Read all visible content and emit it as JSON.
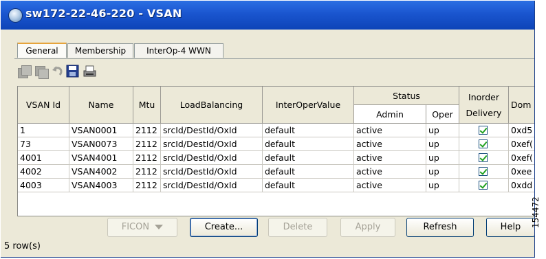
{
  "window": {
    "title": "sw172-22-46-220 - VSAN"
  },
  "tabs": [
    {
      "label": "General",
      "active": true
    },
    {
      "label": "Membership",
      "active": false
    },
    {
      "label": "InterOp-4 WWN",
      "active": false
    }
  ],
  "toolbar": {
    "icons": [
      "copy-icon",
      "paste-icon",
      "undo-icon",
      "save-icon",
      "print-icon"
    ]
  },
  "table": {
    "headers": {
      "vsan_id": "VSAN Id",
      "name": "Name",
      "mtu": "Mtu",
      "load_balancing": "LoadBalancing",
      "interoper_value": "InterOperValue",
      "status": "Status",
      "admin": "Admin",
      "oper": "Oper",
      "inorder_1": "Inorder",
      "inorder_2": "Delivery",
      "domain": "Dom"
    },
    "rows": [
      {
        "vsan_id": "1",
        "name": "VSAN0001",
        "mtu": "2112",
        "load_balancing": "srcId/DestId/OxId",
        "interoper_value": "default",
        "admin": "active",
        "oper": "up",
        "inorder_delivery": true,
        "domain": "0xd5"
      },
      {
        "vsan_id": "73",
        "name": "VSAN0073",
        "mtu": "2112",
        "load_balancing": "srcId/DestId/OxId",
        "interoper_value": "default",
        "admin": "active",
        "oper": "up",
        "inorder_delivery": true,
        "domain": "0xef("
      },
      {
        "vsan_id": "4001",
        "name": "VSAN4001",
        "mtu": "2112",
        "load_balancing": "srcId/DestId/OxId",
        "interoper_value": "default",
        "admin": "active",
        "oper": "up",
        "inorder_delivery": true,
        "domain": "0xef("
      },
      {
        "vsan_id": "4002",
        "name": "VSAN4002",
        "mtu": "2112",
        "load_balancing": "srcId/DestId/OxId",
        "interoper_value": "default",
        "admin": "active",
        "oper": "up",
        "inorder_delivery": true,
        "domain": "0xee"
      },
      {
        "vsan_id": "4003",
        "name": "VSAN4003",
        "mtu": "2112",
        "load_balancing": "srcId/DestId/OxId",
        "interoper_value": "default",
        "admin": "active",
        "oper": "up",
        "inorder_delivery": true,
        "domain": "0xdd"
      }
    ]
  },
  "buttons": {
    "ficon": "FICON",
    "create": "Create...",
    "delete": "Delete",
    "apply": "Apply",
    "refresh": "Refresh",
    "help": "Help"
  },
  "status": {
    "row_count": "5 row(s)"
  },
  "figure_id": "154472",
  "colors": {
    "titlebar": "#1a55cf",
    "checkmark": "#21a121",
    "tab_highlight": "#e6a43c"
  }
}
